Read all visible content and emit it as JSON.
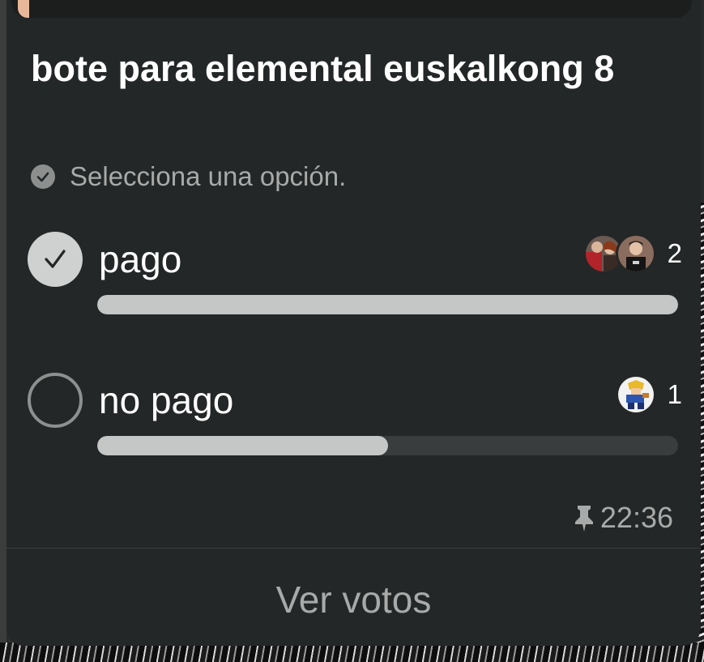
{
  "poll": {
    "title": "bote para elemental euskalkong 8",
    "subtitle": "Selecciona una opción.",
    "subtitle_icon": "check-circle-icon",
    "options": [
      {
        "label": "pago",
        "votes": "2",
        "selected": true,
        "fraction": 1.0,
        "voter_avatars": [
          "avatar-user-1",
          "avatar-user-2"
        ]
      },
      {
        "label": "no pago",
        "votes": "1",
        "selected": false,
        "fraction": 0.5,
        "voter_avatars": [
          "avatar-user-3"
        ]
      }
    ],
    "time": "22:36",
    "pinned_icon": "pin-icon",
    "view_votes_label": "Ver votos"
  },
  "colors": {
    "card_bg": "#242727",
    "bar_fill": "#c5c6c6",
    "bar_track": "#3a3d3d",
    "text_primary": "#ffffff",
    "text_secondary": "#a8aaaa"
  }
}
